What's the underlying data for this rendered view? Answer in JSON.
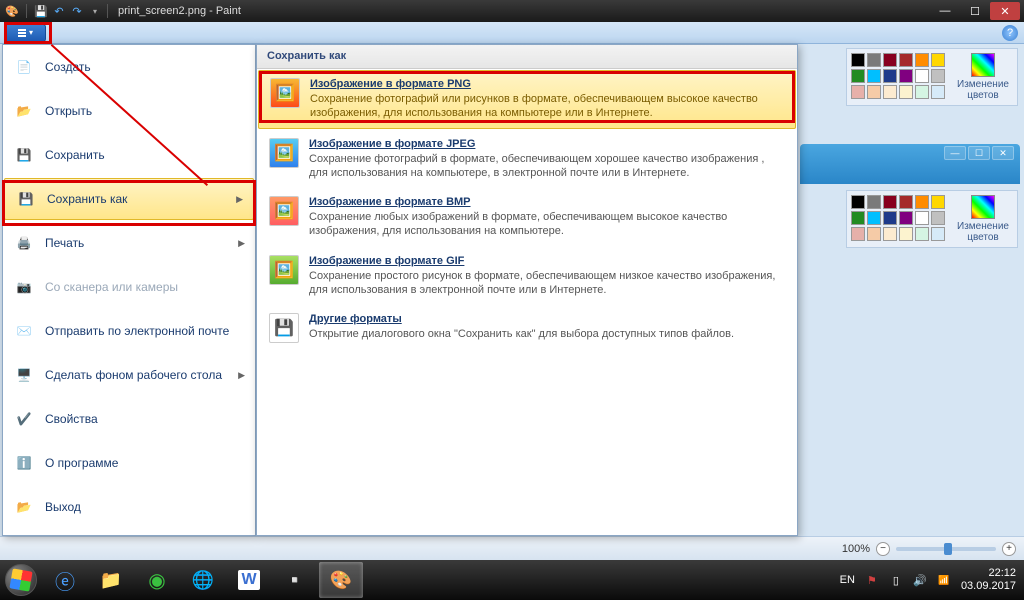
{
  "titlebar": {
    "filename": "print_screen2.png - Paint"
  },
  "file_menu": {
    "items": [
      {
        "label": "Создать",
        "hotkey_underline": "С"
      },
      {
        "label": "Открыть",
        "hotkey_underline": "О"
      },
      {
        "label": "Сохранить",
        "hotkey_underline": "С"
      },
      {
        "label": "Сохранить как",
        "hotkey_underline": "к",
        "selected": true,
        "arrow": true
      },
      {
        "label": "Печать",
        "hotkey_underline": "П",
        "arrow": true
      },
      {
        "label": "Со сканера или камеры",
        "disabled": true
      },
      {
        "label": "Отправить по электронной почте"
      },
      {
        "label": "Сделать фоном рабочего стола",
        "arrow": true
      },
      {
        "label": "Свойства",
        "hotkey_underline": "в"
      },
      {
        "label": "О программе",
        "hotkey_underline": "О"
      },
      {
        "label": "Выход",
        "hotkey_underline": "В"
      }
    ]
  },
  "saveas": {
    "header": "Сохранить как",
    "items": [
      {
        "title": "Изображение в формате PNG",
        "desc": "Сохранение фотографий или рисунков в формате, обеспечивающем высокое качество изображения, для использования на компьютере или в Интернете.",
        "selected": true
      },
      {
        "title": "Изображение в формате JPEG",
        "desc": "Сохранение фотографий в формате, обеспечивающем хорошее качество изображения , для использования на компьютере, в электронной почте или в Интернете."
      },
      {
        "title": "Изображение в формате BMP",
        "desc": "Сохранение любых изображений в формате, обеспечивающем высокое качество изображения, для использования на компьютере."
      },
      {
        "title": "Изображение в формате GIF",
        "desc": "Сохранение простого рисунок в формате, обеспечивающем низкое качество изображения, для использования в электронной почте или в Интернете."
      },
      {
        "title": "Другие форматы",
        "desc": "Открытие диалогового окна \"Сохранить как\" для выбора доступных типов файлов."
      }
    ]
  },
  "palette": {
    "edit_label": "Изменение цветов",
    "top_colors": [
      "#000",
      "#7a7a7a",
      "#87001f",
      "#a52a2a",
      "#ff8c00",
      "#ffd700",
      "#228b22",
      "#00bfff",
      "#1e3a8a",
      "#800080",
      "#fff",
      "#c0c0c0",
      "#e6b0aa",
      "#f5cba7",
      "#fdebd0",
      "#fcf3cf",
      "#d5f5e3",
      "#d6eaf8"
    ],
    "bottom_colors": [
      "#000",
      "#7a7a7a",
      "#87001f",
      "#a52a2a",
      "#ff8c00",
      "#ffd700",
      "#228b22",
      "#00bfff",
      "#1e3a8a",
      "#800080",
      "#fff",
      "#c0c0c0",
      "#e6b0aa",
      "#f5cba7",
      "#fdebd0",
      "#fcf3cf",
      "#d5f5e3",
      "#d6eaf8"
    ]
  },
  "statusbar": {
    "zoom": "100%"
  },
  "tray": {
    "lang": "EN",
    "time": "22:12",
    "date": "03.09.2017"
  }
}
